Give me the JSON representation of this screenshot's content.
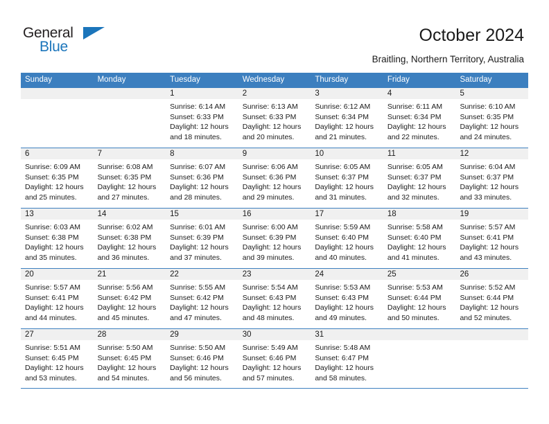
{
  "brand": {
    "name_part1": "General",
    "name_part2": "Blue",
    "triangle_icon": "triangle-icon",
    "color_dark": "#231f20",
    "color_blue": "#1b75bb"
  },
  "header": {
    "title": "October 2024",
    "subtitle": "Braitling, Northern Territory, Australia"
  },
  "calendar": {
    "accent_color": "#3c7fbf",
    "daynum_band_color": "#f0f0f0",
    "weekdays": [
      "Sunday",
      "Monday",
      "Tuesday",
      "Wednesday",
      "Thursday",
      "Friday",
      "Saturday"
    ],
    "weeks": [
      [
        {
          "day": "",
          "lines": []
        },
        {
          "day": "",
          "lines": []
        },
        {
          "day": "1",
          "lines": [
            "Sunrise: 6:14 AM",
            "Sunset: 6:33 PM",
            "Daylight: 12 hours",
            "and 18 minutes."
          ]
        },
        {
          "day": "2",
          "lines": [
            "Sunrise: 6:13 AM",
            "Sunset: 6:33 PM",
            "Daylight: 12 hours",
            "and 20 minutes."
          ]
        },
        {
          "day": "3",
          "lines": [
            "Sunrise: 6:12 AM",
            "Sunset: 6:34 PM",
            "Daylight: 12 hours",
            "and 21 minutes."
          ]
        },
        {
          "day": "4",
          "lines": [
            "Sunrise: 6:11 AM",
            "Sunset: 6:34 PM",
            "Daylight: 12 hours",
            "and 22 minutes."
          ]
        },
        {
          "day": "5",
          "lines": [
            "Sunrise: 6:10 AM",
            "Sunset: 6:35 PM",
            "Daylight: 12 hours",
            "and 24 minutes."
          ]
        }
      ],
      [
        {
          "day": "6",
          "lines": [
            "Sunrise: 6:09 AM",
            "Sunset: 6:35 PM",
            "Daylight: 12 hours",
            "and 25 minutes."
          ]
        },
        {
          "day": "7",
          "lines": [
            "Sunrise: 6:08 AM",
            "Sunset: 6:35 PM",
            "Daylight: 12 hours",
            "and 27 minutes."
          ]
        },
        {
          "day": "8",
          "lines": [
            "Sunrise: 6:07 AM",
            "Sunset: 6:36 PM",
            "Daylight: 12 hours",
            "and 28 minutes."
          ]
        },
        {
          "day": "9",
          "lines": [
            "Sunrise: 6:06 AM",
            "Sunset: 6:36 PM",
            "Daylight: 12 hours",
            "and 29 minutes."
          ]
        },
        {
          "day": "10",
          "lines": [
            "Sunrise: 6:05 AM",
            "Sunset: 6:37 PM",
            "Daylight: 12 hours",
            "and 31 minutes."
          ]
        },
        {
          "day": "11",
          "lines": [
            "Sunrise: 6:05 AM",
            "Sunset: 6:37 PM",
            "Daylight: 12 hours",
            "and 32 minutes."
          ]
        },
        {
          "day": "12",
          "lines": [
            "Sunrise: 6:04 AM",
            "Sunset: 6:37 PM",
            "Daylight: 12 hours",
            "and 33 minutes."
          ]
        }
      ],
      [
        {
          "day": "13",
          "lines": [
            "Sunrise: 6:03 AM",
            "Sunset: 6:38 PM",
            "Daylight: 12 hours",
            "and 35 minutes."
          ]
        },
        {
          "day": "14",
          "lines": [
            "Sunrise: 6:02 AM",
            "Sunset: 6:38 PM",
            "Daylight: 12 hours",
            "and 36 minutes."
          ]
        },
        {
          "day": "15",
          "lines": [
            "Sunrise: 6:01 AM",
            "Sunset: 6:39 PM",
            "Daylight: 12 hours",
            "and 37 minutes."
          ]
        },
        {
          "day": "16",
          "lines": [
            "Sunrise: 6:00 AM",
            "Sunset: 6:39 PM",
            "Daylight: 12 hours",
            "and 39 minutes."
          ]
        },
        {
          "day": "17",
          "lines": [
            "Sunrise: 5:59 AM",
            "Sunset: 6:40 PM",
            "Daylight: 12 hours",
            "and 40 minutes."
          ]
        },
        {
          "day": "18",
          "lines": [
            "Sunrise: 5:58 AM",
            "Sunset: 6:40 PM",
            "Daylight: 12 hours",
            "and 41 minutes."
          ]
        },
        {
          "day": "19",
          "lines": [
            "Sunrise: 5:57 AM",
            "Sunset: 6:41 PM",
            "Daylight: 12 hours",
            "and 43 minutes."
          ]
        }
      ],
      [
        {
          "day": "20",
          "lines": [
            "Sunrise: 5:57 AM",
            "Sunset: 6:41 PM",
            "Daylight: 12 hours",
            "and 44 minutes."
          ]
        },
        {
          "day": "21",
          "lines": [
            "Sunrise: 5:56 AM",
            "Sunset: 6:42 PM",
            "Daylight: 12 hours",
            "and 45 minutes."
          ]
        },
        {
          "day": "22",
          "lines": [
            "Sunrise: 5:55 AM",
            "Sunset: 6:42 PM",
            "Daylight: 12 hours",
            "and 47 minutes."
          ]
        },
        {
          "day": "23",
          "lines": [
            "Sunrise: 5:54 AM",
            "Sunset: 6:43 PM",
            "Daylight: 12 hours",
            "and 48 minutes."
          ]
        },
        {
          "day": "24",
          "lines": [
            "Sunrise: 5:53 AM",
            "Sunset: 6:43 PM",
            "Daylight: 12 hours",
            "and 49 minutes."
          ]
        },
        {
          "day": "25",
          "lines": [
            "Sunrise: 5:53 AM",
            "Sunset: 6:44 PM",
            "Daylight: 12 hours",
            "and 50 minutes."
          ]
        },
        {
          "day": "26",
          "lines": [
            "Sunrise: 5:52 AM",
            "Sunset: 6:44 PM",
            "Daylight: 12 hours",
            "and 52 minutes."
          ]
        }
      ],
      [
        {
          "day": "27",
          "lines": [
            "Sunrise: 5:51 AM",
            "Sunset: 6:45 PM",
            "Daylight: 12 hours",
            "and 53 minutes."
          ]
        },
        {
          "day": "28",
          "lines": [
            "Sunrise: 5:50 AM",
            "Sunset: 6:45 PM",
            "Daylight: 12 hours",
            "and 54 minutes."
          ]
        },
        {
          "day": "29",
          "lines": [
            "Sunrise: 5:50 AM",
            "Sunset: 6:46 PM",
            "Daylight: 12 hours",
            "and 56 minutes."
          ]
        },
        {
          "day": "30",
          "lines": [
            "Sunrise: 5:49 AM",
            "Sunset: 6:46 PM",
            "Daylight: 12 hours",
            "and 57 minutes."
          ]
        },
        {
          "day": "31",
          "lines": [
            "Sunrise: 5:48 AM",
            "Sunset: 6:47 PM",
            "Daylight: 12 hours",
            "and 58 minutes."
          ]
        },
        {
          "day": "",
          "lines": []
        },
        {
          "day": "",
          "lines": []
        }
      ]
    ]
  }
}
